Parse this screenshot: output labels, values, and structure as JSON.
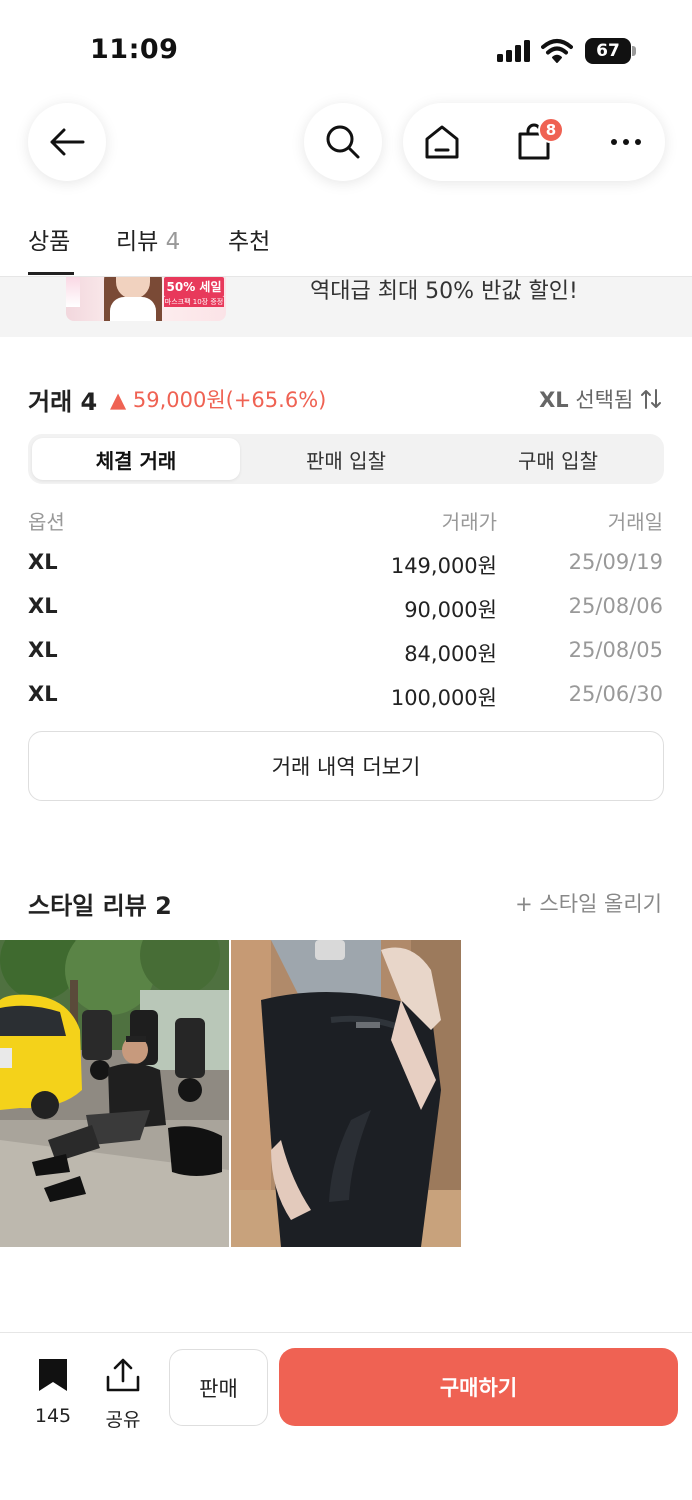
{
  "status_bar": {
    "time": "11:09",
    "battery": "67"
  },
  "nav": {
    "cart_badge": "8"
  },
  "tabs": [
    {
      "label": "상품",
      "count": ""
    },
    {
      "label": "리뷰",
      "count": "4"
    },
    {
      "label": "추천",
      "count": ""
    }
  ],
  "banner": {
    "text": "역대급 최대 50% 반값 할인!",
    "thumb_sale": "50% 세일",
    "thumb_sub": "마스크팩 10장 증정"
  },
  "trade": {
    "title": "거래 4",
    "change_arrow": "▲",
    "change": "59,000원(+65.6%)",
    "size_selected_strong": "XL",
    "size_selected": "선택됨",
    "segments": [
      "체결 거래",
      "판매 입찰",
      "구매 입찰"
    ],
    "active_segment": 0,
    "headers": {
      "option": "옵션",
      "price": "거래가",
      "date": "거래일"
    },
    "rows": [
      {
        "option": "XL",
        "price": "149,000원",
        "date": "25/09/19"
      },
      {
        "option": "XL",
        "price": "90,000원",
        "date": "25/08/06"
      },
      {
        "option": "XL",
        "price": "84,000원",
        "date": "25/08/05"
      },
      {
        "option": "XL",
        "price": "100,000원",
        "date": "25/06/30"
      }
    ],
    "more_button": "거래 내역 더보기"
  },
  "style_reviews": {
    "title": "스타일 리뷰 2",
    "upload": "+ 스타일 올리기"
  },
  "bottom_bar": {
    "bookmark_count": "145",
    "share_label": "공유",
    "sell_label": "판매",
    "buy_label": "구매하기"
  },
  "colors": {
    "accent": "#ef6253",
    "badge": "#ef6253",
    "muted_text": "#999999"
  }
}
